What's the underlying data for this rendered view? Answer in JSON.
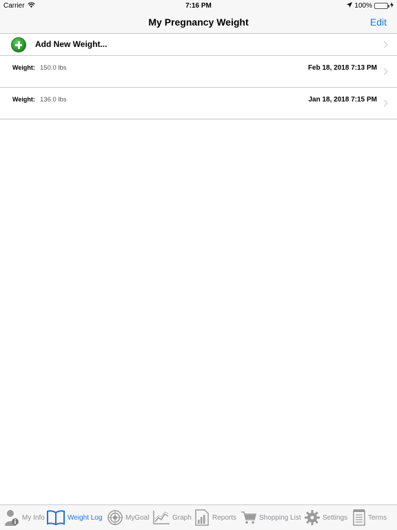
{
  "status_bar": {
    "carrier": "Carrier",
    "time": "7:16 PM",
    "battery": "100%",
    "battery_level": 1.0
  },
  "nav": {
    "title": "My Pregnancy Weight",
    "edit_label": "Edit"
  },
  "list": {
    "add_label": "Add New Weight...",
    "entries": [
      {
        "label": "Weight:",
        "value": "150.0 lbs",
        "date": "Feb 18, 2018 7:13 PM"
      },
      {
        "label": "Weight:",
        "value": "136.0 lbs",
        "date": "Jan 18, 2018 7:15 PM"
      }
    ]
  },
  "tabs": [
    {
      "label": "My Info",
      "icon": "person-info-icon"
    },
    {
      "label": "Weight Log",
      "icon": "book-icon",
      "active": true
    },
    {
      "label": "MyGoal",
      "icon": "target-icon"
    },
    {
      "label": "Graph",
      "icon": "line-graph-icon"
    },
    {
      "label": "Reports",
      "icon": "report-icon"
    },
    {
      "label": "Shopping List",
      "icon": "cart-icon"
    },
    {
      "label": "Settings",
      "icon": "gear-icon"
    },
    {
      "label": "Terms",
      "icon": "notepad-icon"
    }
  ],
  "colors": {
    "accent": "#1a73e8",
    "add_green": "#2e9e2e",
    "inactive_tab": "#8e8e93"
  }
}
